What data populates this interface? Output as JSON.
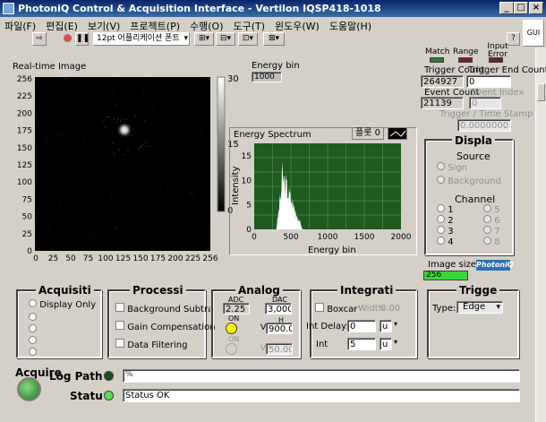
{
  "window": {
    "title": "PhotoniQ Control & Acquisition Interface - Vertilon IQSP418-1018"
  },
  "menu": [
    "파일(F)",
    "편집(E)",
    "보기(V)",
    "프로젝트(P)",
    "수행(O)",
    "도구(T)",
    "윈도우(W)",
    "도움말(H)"
  ],
  "toolbar": {
    "font_label": "12pt 어플리케이션 폰트",
    "gui_label": "GUI"
  },
  "image": {
    "title": "Real-time Image",
    "y_ticks": [
      "256",
      "225",
      "200",
      "175",
      "150",
      "125",
      "100",
      "75",
      "50",
      "25",
      "0"
    ],
    "x_ticks": [
      "0",
      "25",
      "50",
      "75",
      "100",
      "125",
      "150",
      "175",
      "200",
      "225",
      "256"
    ],
    "colorbar_ticks": [
      "30",
      "15",
      "0"
    ]
  },
  "energy_bin": {
    "label": "Energy bin",
    "value": "1000"
  },
  "spectrum": {
    "title": "Energy Spectrum",
    "cursor_label": "플롯 0",
    "y_label": "Intensity",
    "x_label": "Energy bin",
    "y_ticks": [
      "15",
      "10",
      "5",
      "0"
    ],
    "x_ticks": [
      "0",
      "500",
      "1000",
      "1500",
      "2000"
    ]
  },
  "status_leds": {
    "match": "Match",
    "range": "Range",
    "input_error": "Input Error"
  },
  "counters": {
    "trigger_count_label": "Trigger Count",
    "trigger_count": "264927",
    "trigger_end_count_label": "Trigger End Count",
    "trigger_end_count": "0",
    "event_count_label": "Event Count",
    "event_count": "21139",
    "event_index_label": "Event Index",
    "event_index": "0",
    "trigger_time_label": "Trigger / Time Stamp",
    "trigger_time": "0.0000000"
  },
  "display": {
    "title": "Displa",
    "source_label": "Source",
    "source_options": [
      "Sign",
      "Background"
    ],
    "channel_label": "Channel",
    "channels_left": [
      "1",
      "2",
      "3",
      "4"
    ],
    "channels_right": [
      "5",
      "6",
      "7",
      "8"
    ]
  },
  "image_size": {
    "label": "Image size",
    "value": "256",
    "logo": "PhotoniQ"
  },
  "acquisition": {
    "title": "Acquisiti",
    "display_only": "Display Only"
  },
  "processing": {
    "title": "Processi",
    "options": [
      "Background Subtractio",
      "Gain Compensation",
      "Data Filtering"
    ]
  },
  "analog": {
    "title": "Analog",
    "adc_label": "ADC",
    "dac_label": "DAC",
    "adc_value": "2.25",
    "dac_value": "3,000",
    "on_label": "ON",
    "h_label": "H",
    "v_label": "V",
    "v1_value": "900.0",
    "v2_value": "50.00"
  },
  "integration": {
    "title": "Integrati",
    "boxcar_label": "Boxcar",
    "width_label": "Width",
    "width_value": "0.00",
    "int_delay_label": "Int Delay:",
    "int_delay_value": "0",
    "int_label": "Int",
    "int_value": "5",
    "unit": "u"
  },
  "trigger": {
    "title": "Trigge",
    "type_label": "Type:",
    "type_value": "Edge"
  },
  "bottom": {
    "acquire_label": "Acquire",
    "log_path_label": "Log Path",
    "log_path_value": "",
    "status_label": "Statu",
    "status_value": "Status OK",
    "path_glyph": "%"
  },
  "colors": {
    "led_green": "#39d739",
    "status_green": "#55e055",
    "led_yellow": "#f5f500",
    "spectrum_bg": "#1f5a1f",
    "titlebar": "#0a246a"
  }
}
